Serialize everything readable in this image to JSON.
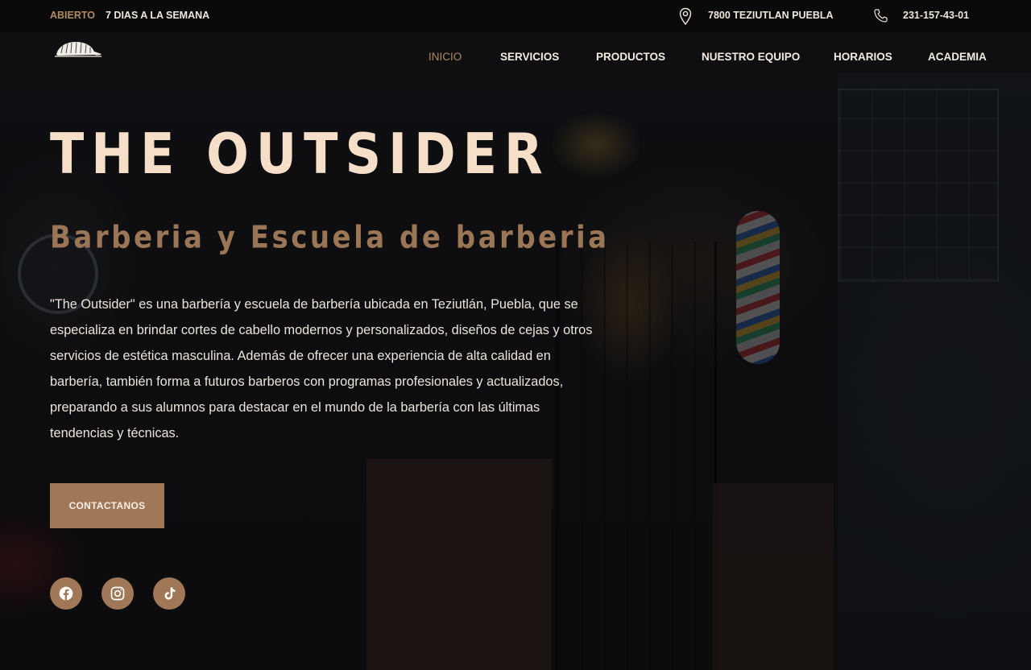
{
  "topbar": {
    "open_label": "ABIERTO",
    "days_label": "7 DIAS A LA SEMANA",
    "address": "7800 TEZIUTLAN PUEBLA",
    "phone": "231-157-43-01",
    "address_icon": "map-pin-icon",
    "phone_icon": "phone-icon"
  },
  "nav": {
    "logo_icon": "armadillo-logo-icon",
    "items": [
      {
        "label": "INICIO",
        "active": true
      },
      {
        "label": "SERVICIOS",
        "active": false
      },
      {
        "label": "PRODUCTOS",
        "active": false
      },
      {
        "label": "NUESTRO EQUIPO",
        "active": false
      },
      {
        "label": "HORARIOS",
        "active": false
      },
      {
        "label": "ACADEMIA",
        "active": false
      }
    ]
  },
  "hero": {
    "title": "THE OUTSIDER",
    "subtitle": "Barberia y Escuela de barberia",
    "description": "\"The Outsider\" es una barbería y escuela de barbería ubicada en Teziutlán, Puebla, que se especializa en brindar cortes de cabello modernos y personalizados, diseños de cejas y otros servicios de estética masculina. Además de ofrecer una experiencia de alta calidad en barbería, también forma a futuros barberos con programas profesionales y actualizados, preparando a sus alumnos para destacar en el mundo de la barbería con las últimas tendencias y técnicas.",
    "cta_label": "CONTACTANOS"
  },
  "social": [
    {
      "icon": "facebook-icon"
    },
    {
      "icon": "instagram-icon"
    },
    {
      "icon": "tiktok-icon"
    }
  ],
  "colors": {
    "accent": "#a07858",
    "accent_text": "#b08a64",
    "title": "#f6dfc9",
    "subtitle": "#9a7656",
    "body_text": "#ece4da",
    "topbar_bg": "#0a0a0b"
  }
}
